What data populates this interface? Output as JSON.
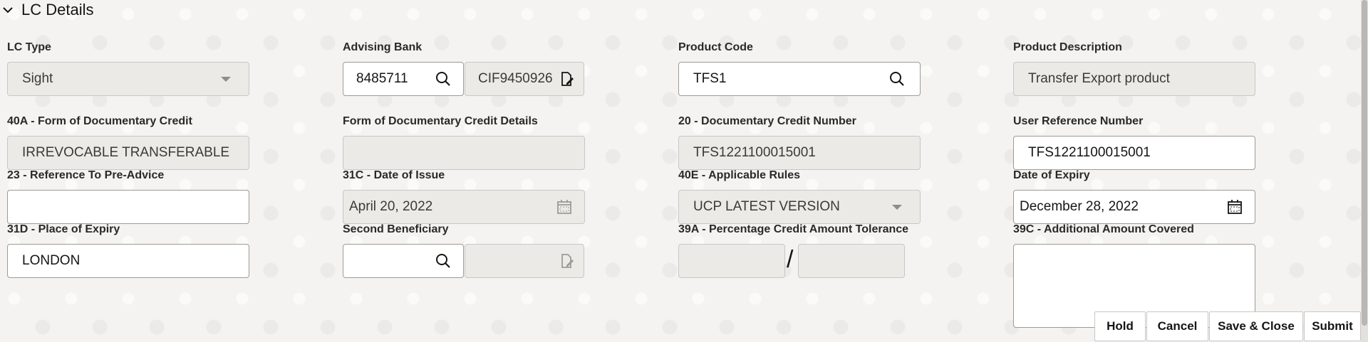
{
  "section": {
    "title": "LC Details"
  },
  "fields": {
    "lc_type": {
      "label": "LC Type",
      "value": "Sight"
    },
    "advising_bank": {
      "label": "Advising Bank",
      "code": "8485711",
      "name": "CIF9450926"
    },
    "product_code": {
      "label": "Product Code",
      "value": "TFS1"
    },
    "product_description": {
      "label": "Product Description",
      "value": "Transfer Export product"
    },
    "form_of_credit": {
      "label": "40A - Form of Documentary Credit",
      "value": "IRREVOCABLE TRANSFERABLE"
    },
    "form_of_credit_details": {
      "label": "Form of Documentary Credit Details",
      "value": ""
    },
    "credit_number": {
      "label": "20 - Documentary Credit Number",
      "value": "TFS1221100015001"
    },
    "user_reference": {
      "label": "User Reference Number",
      "value": "TFS1221100015001"
    },
    "pre_advice_ref": {
      "label": "23 - Reference To Pre-Advice",
      "value": ""
    },
    "date_of_issue": {
      "label": "31C - Date of Issue",
      "value": "April 20, 2022"
    },
    "applicable_rules": {
      "label": "40E - Applicable Rules",
      "value": "UCP LATEST VERSION"
    },
    "date_of_expiry": {
      "label": "Date of Expiry",
      "value": "December 28, 2022"
    },
    "place_of_expiry": {
      "label": "31D - Place of Expiry",
      "value": "LONDON"
    },
    "second_beneficiary": {
      "label": "Second Beneficiary",
      "value": ""
    },
    "tolerance": {
      "label": "39A - Percentage Credit Amount Tolerance",
      "separator": "/"
    },
    "additional_amount": {
      "label": "39C - Additional Amount Covered",
      "value": ""
    }
  },
  "buttons": {
    "hold": "Hold",
    "cancel": "Cancel",
    "save_close": "Save & Close",
    "submit": "Submit"
  },
  "icons": {
    "search": "search-icon",
    "edit_doc": "edit-document-icon",
    "calendar": "calendar-icon",
    "chevron": "chevron-down-icon"
  }
}
